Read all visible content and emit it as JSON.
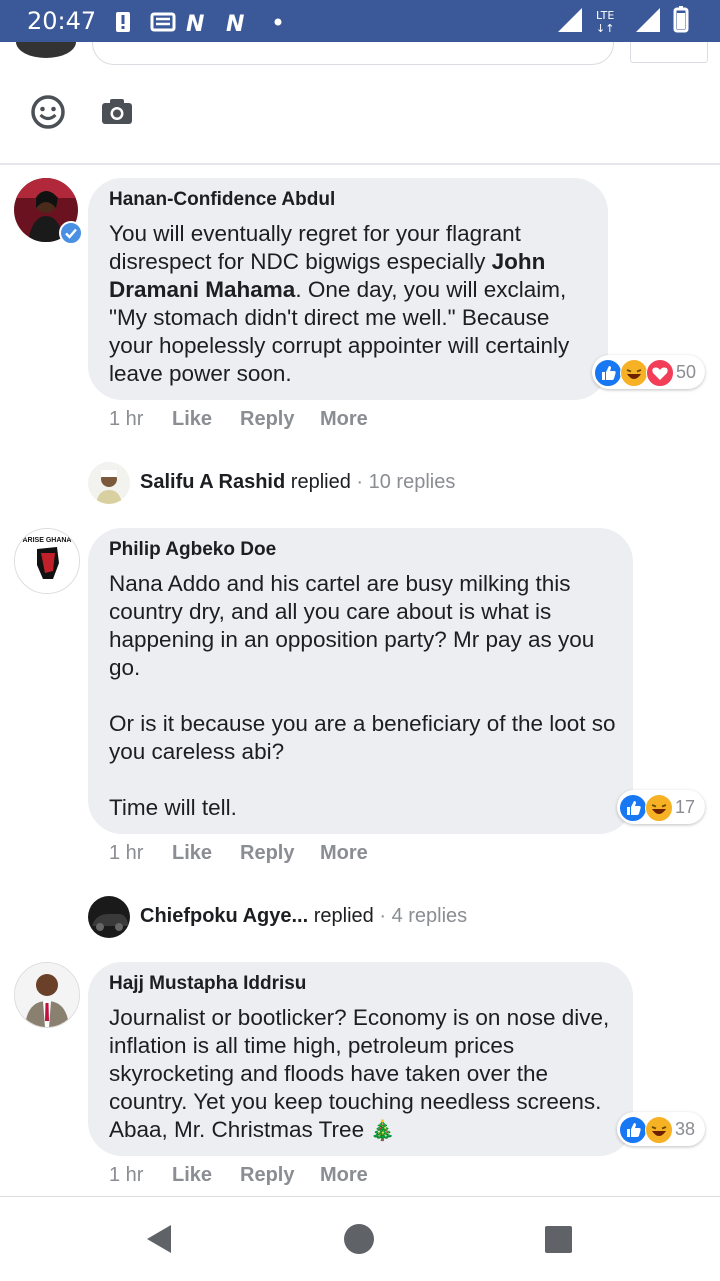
{
  "status_bar": {
    "time": "20:47",
    "network": "LTE",
    "network_arrows": "↓↑"
  },
  "composer": {
    "emoji_icon": "smiley-icon",
    "camera_icon": "camera-icon"
  },
  "comments": [
    {
      "author": "Hanan-Confidence Abdul",
      "verified": true,
      "body_parts": [
        "You will eventually regret for your flagrant disrespect for NDC bigwigs especially ",
        "John Dramani Mahama",
        ". One day, you will exclaim, \"My stomach didn't direct me well.\" Because your hopelessly corrupt appointer will certainly leave power soon."
      ],
      "reaction_count": "50",
      "reactions": [
        "like",
        "haha",
        "love"
      ],
      "time": "1 hr",
      "like_label": "Like",
      "reply_label": "Reply",
      "more_label": "More",
      "reply_summary": {
        "name": "Salifu A Rashid",
        "action": "replied",
        "separator": "·",
        "count": "10 replies"
      }
    },
    {
      "author": "Philip Agbeko Doe",
      "avatar_text": "ARISE GHANA",
      "body_paragraphs": [
        "Nana Addo and his cartel are busy milking this country dry, and all you care about is what is happening in an opposition party? Mr pay as you go.",
        "Or is it because you are a beneficiary of the loot so you careless abi?",
        "Time will tell."
      ],
      "reaction_count": "17",
      "reactions": [
        "like",
        "haha"
      ],
      "time": "1 hr",
      "like_label": "Like",
      "reply_label": "Reply",
      "more_label": "More",
      "reply_summary": {
        "name": "Chiefpoku Agye...",
        "action": "replied",
        "separator": "·",
        "count": "4 replies"
      }
    },
    {
      "author": "Hajj Mustapha Iddrisu",
      "body": "Journalist or bootlicker? Economy is on nose dive, inflation is all time high, petroleum prices skyrocketing and floods have taken over the country. Yet you keep touching needless screens. Abaa, Mr. Christmas Tree",
      "body_emoji": "🎄",
      "reaction_count": "38",
      "reactions": [
        "like",
        "haha"
      ],
      "time": "1 hr",
      "like_label": "Like",
      "reply_label": "Reply",
      "more_label": "More"
    }
  ],
  "nav": {
    "back": "back-icon",
    "home": "home-icon",
    "recents": "recents-icon"
  },
  "colors": {
    "status_bar": "#3b5998",
    "bubble": "#edeef1",
    "like_blue": "#1877f2",
    "verified": "#4a90e2",
    "love_red": "#f33e58",
    "haha_yellow": "#f7b125",
    "meta_gray": "#8a8d91"
  }
}
